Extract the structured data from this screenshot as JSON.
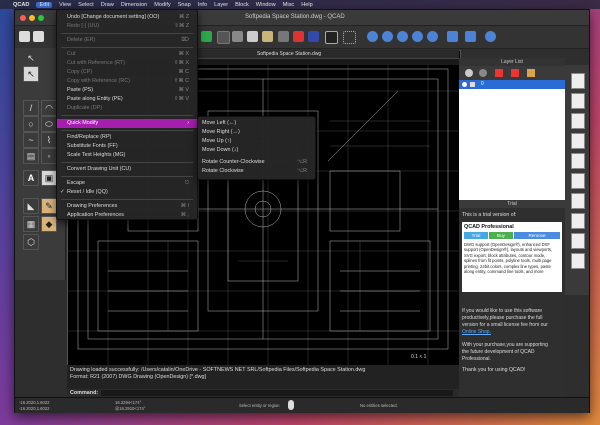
{
  "menubar": {
    "apple": "",
    "items": [
      "QCAD",
      "Edit",
      "View",
      "Select",
      "Draw",
      "Dimension",
      "Modify",
      "Snap",
      "Info",
      "Layer",
      "Block",
      "Window",
      "Misc",
      "Help"
    ],
    "active_index": 1
  },
  "window": {
    "title": "Softpedia Space Station.dwg - QCAD"
  },
  "drawing": {
    "tab_title": "Softpedia Space Station.dwg",
    "coord_readout": "0.1 < 1"
  },
  "edit_menu": {
    "items": [
      {
        "label": "Undo [Change document setting] (OO)",
        "shortcut": "⌘ Z",
        "disabled": false
      },
      {
        "label": "Redo [-] (UU)",
        "shortcut": "⇧⌘ Z",
        "disabled": true
      },
      {
        "label": "Delete (ER)",
        "shortcut": "⌦",
        "disabled": true
      },
      {
        "label": "Cut",
        "shortcut": "⌘ X",
        "disabled": true
      },
      {
        "label": "Cut with Reference (RT)",
        "shortcut": "⇧⌘ X",
        "disabled": true
      },
      {
        "label": "Copy (CP)",
        "shortcut": "⌘ C",
        "disabled": true
      },
      {
        "label": "Copy with Reference (RC)",
        "shortcut": "⇧⌘ C",
        "disabled": true
      },
      {
        "label": "Paste (PS)",
        "shortcut": "⌘ V",
        "disabled": false
      },
      {
        "label": "Paste along Entity (PE)",
        "shortcut": "⇧⌘ V",
        "disabled": false
      },
      {
        "label": "Duplicate (DP)",
        "shortcut": "",
        "disabled": true
      },
      {
        "label": "Quick Modify",
        "shortcut": "",
        "disabled": false,
        "submenu": true
      },
      {
        "label": "Find/Replace (RP)",
        "shortcut": "",
        "disabled": false
      },
      {
        "label": "Substitute Fonts (FF)",
        "shortcut": "",
        "disabled": false
      },
      {
        "label": "Scale Text Heights (MG)",
        "shortcut": "",
        "disabled": false
      },
      {
        "label": "Convert Drawing Unit (CU)",
        "shortcut": "",
        "disabled": false
      },
      {
        "label": "Escape",
        "shortcut": "⎋",
        "disabled": false
      },
      {
        "label": "Reset / Idle (QQ)",
        "shortcut": "",
        "disabled": false,
        "checked": true
      },
      {
        "label": "Drawing Preferences",
        "shortcut": "⌘ I",
        "disabled": false
      },
      {
        "label": "Application Preferences",
        "shortcut": "⌘ ,",
        "disabled": false
      }
    ]
  },
  "quick_modify": {
    "items": [
      {
        "label": "Move Left (←)",
        "shortcut": ""
      },
      {
        "label": "Move Right (→)",
        "shortcut": ""
      },
      {
        "label": "Move Up (↑)",
        "shortcut": ""
      },
      {
        "label": "Move Down (↓)",
        "shortcut": ""
      },
      {
        "label": "Rotate Counter-Clockwise",
        "shortcut": "⌥R"
      },
      {
        "label": "Rotate Clockwise",
        "shortcut": "⌥R"
      }
    ]
  },
  "layer_list": {
    "title": "Layer List",
    "layer0": "0"
  },
  "trial": {
    "panel_title": "Trial",
    "intro": "This is a trial version of:",
    "product_title": "QCAD Professional",
    "tabs": [
      "Trial",
      "Buy",
      "Remove"
    ],
    "desc": [
      "DWG support (OpenDesign®), enhanced DXF",
      "support (OpenDesign®), layouts and viewports,",
      "SVG export, block attributes, contour mode,",
      "splines from fit points, polyline tools, multi page",
      "printing, 24bit colors, complex line types, paste",
      "along entity, command line tools, and more"
    ],
    "purchase": [
      "If you would like to use this software",
      "productively,please purchase the full",
      "version for a small license fee from our"
    ],
    "shop_link": "Online Shop.",
    "support": [
      "With your purchase,you are supporting",
      "the future development of QCAD",
      "Professional."
    ],
    "thanks": "Thank you for using QCAD!"
  },
  "command": {
    "history1": "Drawing loaded successfully: /Users/catalin/OneDrive - SOFTNEWS NET SRL/Softpedia Files/Softpedia Space Station.dwg",
    "history2": "Format: R21 (2007) DWG Drawing (OpenDesign) [*.dwg]",
    "label": "Command:"
  },
  "status": {
    "coord1": "-16.2020,1.6022",
    "coord2": "-16.2020,1.6022",
    "coord3": "16.2294<174°",
    "coord4": "@16.2910<174°",
    "select_hint": "Select entity or region",
    "no_selection": "No entities selected."
  },
  "colors": {
    "menu_highlight": "#a51eb0",
    "selected_tab": "#3c6fd1"
  }
}
